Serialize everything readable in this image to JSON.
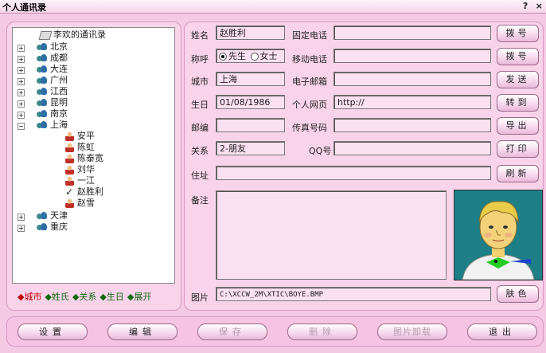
{
  "window": {
    "title": "个人通讯录",
    "help_glyph": "?",
    "close_glyph": "×"
  },
  "tree": {
    "root": "李欢的通讯录",
    "groups": [
      "北京",
      "成都",
      "大连",
      "广州",
      "江西",
      "昆明",
      "南京",
      "上海"
    ],
    "shanghai_contacts": [
      "安平",
      "陈虹",
      "陈泰宽",
      "刘华",
      "一江",
      "赵胜利",
      "赵雪"
    ],
    "groups_after": [
      "天津",
      "重庆"
    ]
  },
  "filters": [
    "◆城市",
    "◆姓氏",
    "◆关系",
    "◆生日",
    "◆展开"
  ],
  "colors": {
    "filter_active": "#c00000",
    "filter_inactive": "#0a6a0a"
  },
  "form": {
    "name_label": "姓名",
    "name_value": "赵胜利",
    "phone_label": "固定电话",
    "phone_value": "",
    "title_label": "称呼",
    "title_option_male": "先生",
    "title_option_female": "女士",
    "mobile_label": "移动电话",
    "mobile_value": "",
    "city_label": "城市",
    "city_value": "上海",
    "email_label": "电子邮箱",
    "email_value": "",
    "birthday_label": "生日",
    "birthday_value": "01/08/1986",
    "homepage_label": "个人网页",
    "homepage_value": "http://",
    "zip_label": "邮编",
    "zip_value": "",
    "fax_label": "传真号码",
    "fax_value": "",
    "relation_label": "关系",
    "relation_value": "2-朋友",
    "qq_label": "QQ号",
    "qq_value": "",
    "address_label": "住址",
    "address_value": "",
    "notes_label": "备注",
    "notes_value": "",
    "photo_label": "图片",
    "photo_value": "C:\\XCCW_2M\\XTIC\\BOYE.BMP"
  },
  "side_buttons": [
    "拨号",
    "拨号",
    "发送",
    "转到",
    "导出",
    "打印",
    "刷新"
  ],
  "skin_button": "肤色",
  "bottom_buttons": [
    {
      "label": "设置",
      "enabled": true
    },
    {
      "label": "编辑",
      "enabled": true
    },
    {
      "label": "保存",
      "enabled": false
    },
    {
      "label": "删除",
      "enabled": false
    },
    {
      "label": "图片卸载",
      "enabled": false
    },
    {
      "label": "退出",
      "enabled": true
    }
  ]
}
